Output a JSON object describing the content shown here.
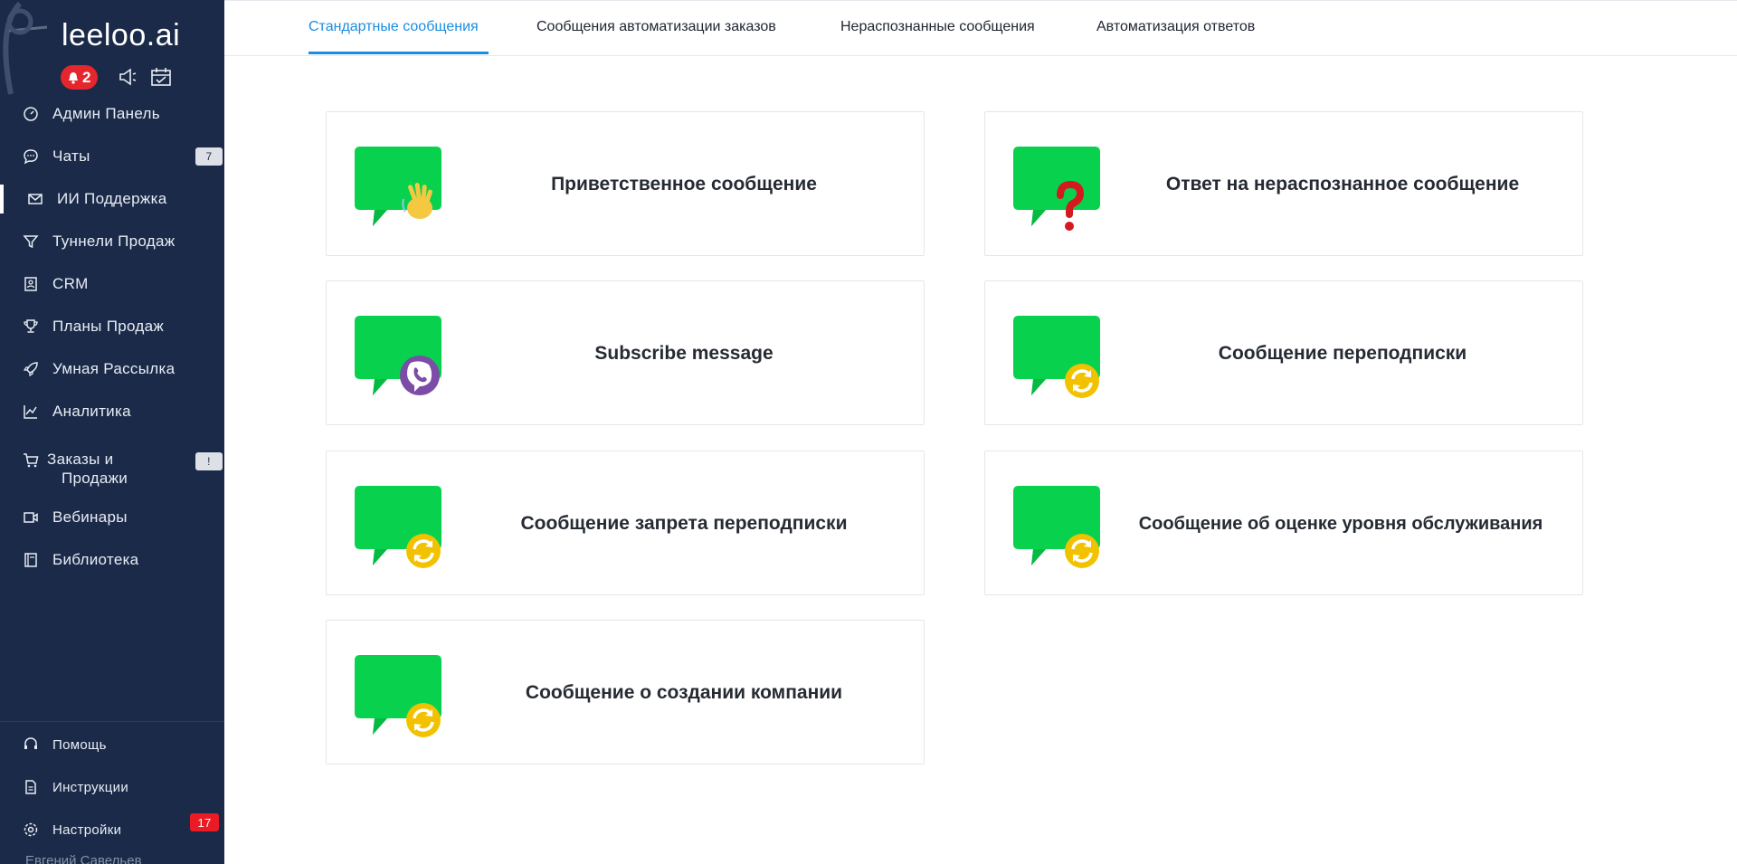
{
  "app": {
    "logo_text": "leeloo.ai",
    "notifications_count": "2"
  },
  "sidebar": {
    "items": [
      {
        "label": "Админ Панель",
        "icon": "dashboard-gauge-icon"
      },
      {
        "label": "Чаты",
        "icon": "chat-bubble-icon",
        "badge": "7"
      },
      {
        "label": "ИИ Поддержка",
        "icon": "envelope-icon",
        "active": true
      },
      {
        "label": "Туннели Продаж",
        "icon": "funnel-icon"
      },
      {
        "label": "CRM",
        "icon": "contact-card-icon"
      },
      {
        "label": "Планы Продаж",
        "icon": "trophy-icon"
      },
      {
        "label": "Умная Рассылка",
        "icon": "rocket-icon"
      },
      {
        "label": "Аналитика",
        "icon": "line-chart-icon"
      },
      {
        "label": "Заказы и",
        "label2": "Продажи",
        "icon": "cart-icon",
        "badge": "!"
      },
      {
        "label": "Вебинары",
        "icon": "video-camera-icon"
      },
      {
        "label": "Библиотека",
        "icon": "book-icon"
      }
    ],
    "bottom": [
      {
        "label": "Помощь",
        "icon": "headset-icon"
      },
      {
        "label": "Инструкции",
        "icon": "document-icon"
      },
      {
        "label": "Настройки",
        "icon": "gear-icon",
        "badge": "17"
      }
    ],
    "user_name": "Евгений Савельев"
  },
  "tabs": [
    {
      "label": "Стандартные сообщения",
      "active": true
    },
    {
      "label": "Сообщения автоматизации заказов"
    },
    {
      "label": "Нераспознанные сообщения"
    },
    {
      "label": "Автоматизация ответов"
    }
  ],
  "cards": [
    {
      "title": "Приветственное сообщение",
      "icon": "green-bubble-wave-hand-icon"
    },
    {
      "title": "Ответ на нераспознанное сообщение",
      "icon": "green-bubble-question-mark-icon"
    },
    {
      "title": "Subscribe message",
      "icon": "green-bubble-viber-icon"
    },
    {
      "title": "Сообщение переподписки",
      "icon": "green-bubble-refresh-icon"
    },
    {
      "title": "Сообщение запрета переподписки",
      "icon": "green-bubble-refresh-icon"
    },
    {
      "title": "Сообщение об оценке уровня обслуживания",
      "icon": "green-bubble-refresh-icon"
    },
    {
      "title": "Сообщение о создании компании",
      "icon": "green-bubble-refresh-icon"
    }
  ],
  "colors": {
    "sidebar_bg": "#1b2a48",
    "accent_blue": "#1a8ee0",
    "bubble_green": "#08d14e",
    "badge_red": "#e5262c",
    "refresh_yellow": "#f2c200"
  }
}
